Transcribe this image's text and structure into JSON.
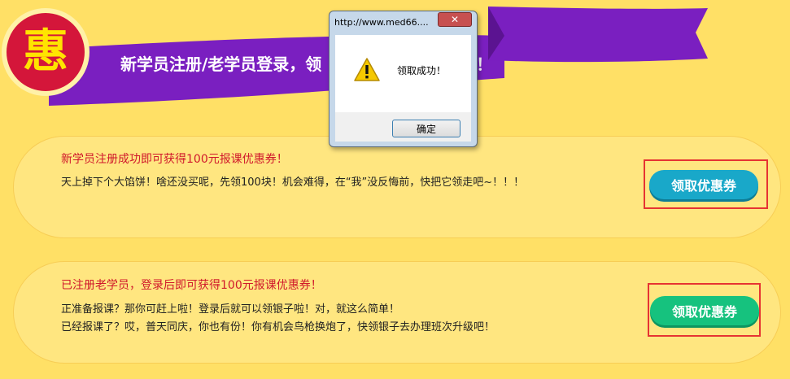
{
  "banner": {
    "badge_text": "惠",
    "title": "新学员注册/老学员登录，领",
    "title_tail": "券！"
  },
  "coupons": [
    {
      "title": "新学员注册成功即可获得100元报课优惠券！",
      "lines": [
        "天上掉下个大馅饼！啥还没买呢，先领100块！机会难得，在“我”没反悔前，快把它领走吧~！！！"
      ],
      "button_label": "领取优惠券",
      "button_color": "#19a8c9"
    },
    {
      "title": "已注册老学员，登录后即可获得100元报课优惠券！",
      "lines": [
        "正准备报课？那你可赶上啦！登录后就可以领银子啦！对，就这么简单！",
        "已经报课了？哎，普天同庆，你也有份！你有机会鸟枪换炮了，快领银子去办理班次升级吧！"
      ],
      "button_label": "领取优惠券",
      "button_color": "#16c27e"
    }
  ],
  "dialog": {
    "title": "http://www.med66....",
    "close_label": "✕",
    "icon": "warning-icon",
    "message": "领取成功！",
    "ok_label": "确定"
  },
  "colors": {
    "background": "#ffe066",
    "ribbon": "#7a1fc0",
    "badge": "#d4163a",
    "coupon_title": "#d0182b",
    "highlight_box": "#e63333"
  }
}
